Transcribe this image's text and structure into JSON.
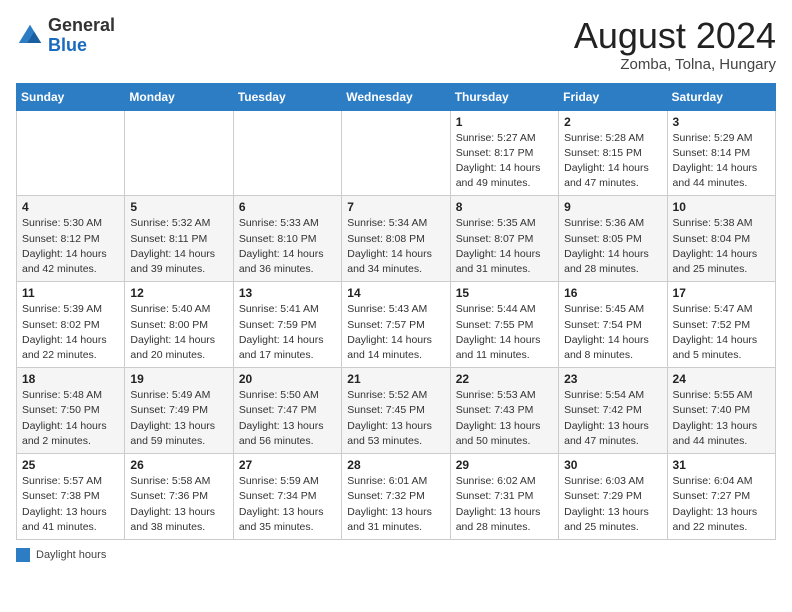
{
  "header": {
    "logo_line1": "General",
    "logo_line2": "Blue",
    "title": "August 2024",
    "location": "Zomba, Tolna, Hungary"
  },
  "legend": {
    "box_color": "#2d7dc5",
    "label": "Daylight hours"
  },
  "weekdays": [
    "Sunday",
    "Monday",
    "Tuesday",
    "Wednesday",
    "Thursday",
    "Friday",
    "Saturday"
  ],
  "weeks": [
    [
      {
        "day": "",
        "info": ""
      },
      {
        "day": "",
        "info": ""
      },
      {
        "day": "",
        "info": ""
      },
      {
        "day": "",
        "info": ""
      },
      {
        "day": "1",
        "info": "Sunrise: 5:27 AM\nSunset: 8:17 PM\nDaylight: 14 hours and 49 minutes."
      },
      {
        "day": "2",
        "info": "Sunrise: 5:28 AM\nSunset: 8:15 PM\nDaylight: 14 hours and 47 minutes."
      },
      {
        "day": "3",
        "info": "Sunrise: 5:29 AM\nSunset: 8:14 PM\nDaylight: 14 hours and 44 minutes."
      }
    ],
    [
      {
        "day": "4",
        "info": "Sunrise: 5:30 AM\nSunset: 8:12 PM\nDaylight: 14 hours and 42 minutes."
      },
      {
        "day": "5",
        "info": "Sunrise: 5:32 AM\nSunset: 8:11 PM\nDaylight: 14 hours and 39 minutes."
      },
      {
        "day": "6",
        "info": "Sunrise: 5:33 AM\nSunset: 8:10 PM\nDaylight: 14 hours and 36 minutes."
      },
      {
        "day": "7",
        "info": "Sunrise: 5:34 AM\nSunset: 8:08 PM\nDaylight: 14 hours and 34 minutes."
      },
      {
        "day": "8",
        "info": "Sunrise: 5:35 AM\nSunset: 8:07 PM\nDaylight: 14 hours and 31 minutes."
      },
      {
        "day": "9",
        "info": "Sunrise: 5:36 AM\nSunset: 8:05 PM\nDaylight: 14 hours and 28 minutes."
      },
      {
        "day": "10",
        "info": "Sunrise: 5:38 AM\nSunset: 8:04 PM\nDaylight: 14 hours and 25 minutes."
      }
    ],
    [
      {
        "day": "11",
        "info": "Sunrise: 5:39 AM\nSunset: 8:02 PM\nDaylight: 14 hours and 22 minutes."
      },
      {
        "day": "12",
        "info": "Sunrise: 5:40 AM\nSunset: 8:00 PM\nDaylight: 14 hours and 20 minutes."
      },
      {
        "day": "13",
        "info": "Sunrise: 5:41 AM\nSunset: 7:59 PM\nDaylight: 14 hours and 17 minutes."
      },
      {
        "day": "14",
        "info": "Sunrise: 5:43 AM\nSunset: 7:57 PM\nDaylight: 14 hours and 14 minutes."
      },
      {
        "day": "15",
        "info": "Sunrise: 5:44 AM\nSunset: 7:55 PM\nDaylight: 14 hours and 11 minutes."
      },
      {
        "day": "16",
        "info": "Sunrise: 5:45 AM\nSunset: 7:54 PM\nDaylight: 14 hours and 8 minutes."
      },
      {
        "day": "17",
        "info": "Sunrise: 5:47 AM\nSunset: 7:52 PM\nDaylight: 14 hours and 5 minutes."
      }
    ],
    [
      {
        "day": "18",
        "info": "Sunrise: 5:48 AM\nSunset: 7:50 PM\nDaylight: 14 hours and 2 minutes."
      },
      {
        "day": "19",
        "info": "Sunrise: 5:49 AM\nSunset: 7:49 PM\nDaylight: 13 hours and 59 minutes."
      },
      {
        "day": "20",
        "info": "Sunrise: 5:50 AM\nSunset: 7:47 PM\nDaylight: 13 hours and 56 minutes."
      },
      {
        "day": "21",
        "info": "Sunrise: 5:52 AM\nSunset: 7:45 PM\nDaylight: 13 hours and 53 minutes."
      },
      {
        "day": "22",
        "info": "Sunrise: 5:53 AM\nSunset: 7:43 PM\nDaylight: 13 hours and 50 minutes."
      },
      {
        "day": "23",
        "info": "Sunrise: 5:54 AM\nSunset: 7:42 PM\nDaylight: 13 hours and 47 minutes."
      },
      {
        "day": "24",
        "info": "Sunrise: 5:55 AM\nSunset: 7:40 PM\nDaylight: 13 hours and 44 minutes."
      }
    ],
    [
      {
        "day": "25",
        "info": "Sunrise: 5:57 AM\nSunset: 7:38 PM\nDaylight: 13 hours and 41 minutes."
      },
      {
        "day": "26",
        "info": "Sunrise: 5:58 AM\nSunset: 7:36 PM\nDaylight: 13 hours and 38 minutes."
      },
      {
        "day": "27",
        "info": "Sunrise: 5:59 AM\nSunset: 7:34 PM\nDaylight: 13 hours and 35 minutes."
      },
      {
        "day": "28",
        "info": "Sunrise: 6:01 AM\nSunset: 7:32 PM\nDaylight: 13 hours and 31 minutes."
      },
      {
        "day": "29",
        "info": "Sunrise: 6:02 AM\nSunset: 7:31 PM\nDaylight: 13 hours and 28 minutes."
      },
      {
        "day": "30",
        "info": "Sunrise: 6:03 AM\nSunset: 7:29 PM\nDaylight: 13 hours and 25 minutes."
      },
      {
        "day": "31",
        "info": "Sunrise: 6:04 AM\nSunset: 7:27 PM\nDaylight: 13 hours and 22 minutes."
      }
    ]
  ]
}
